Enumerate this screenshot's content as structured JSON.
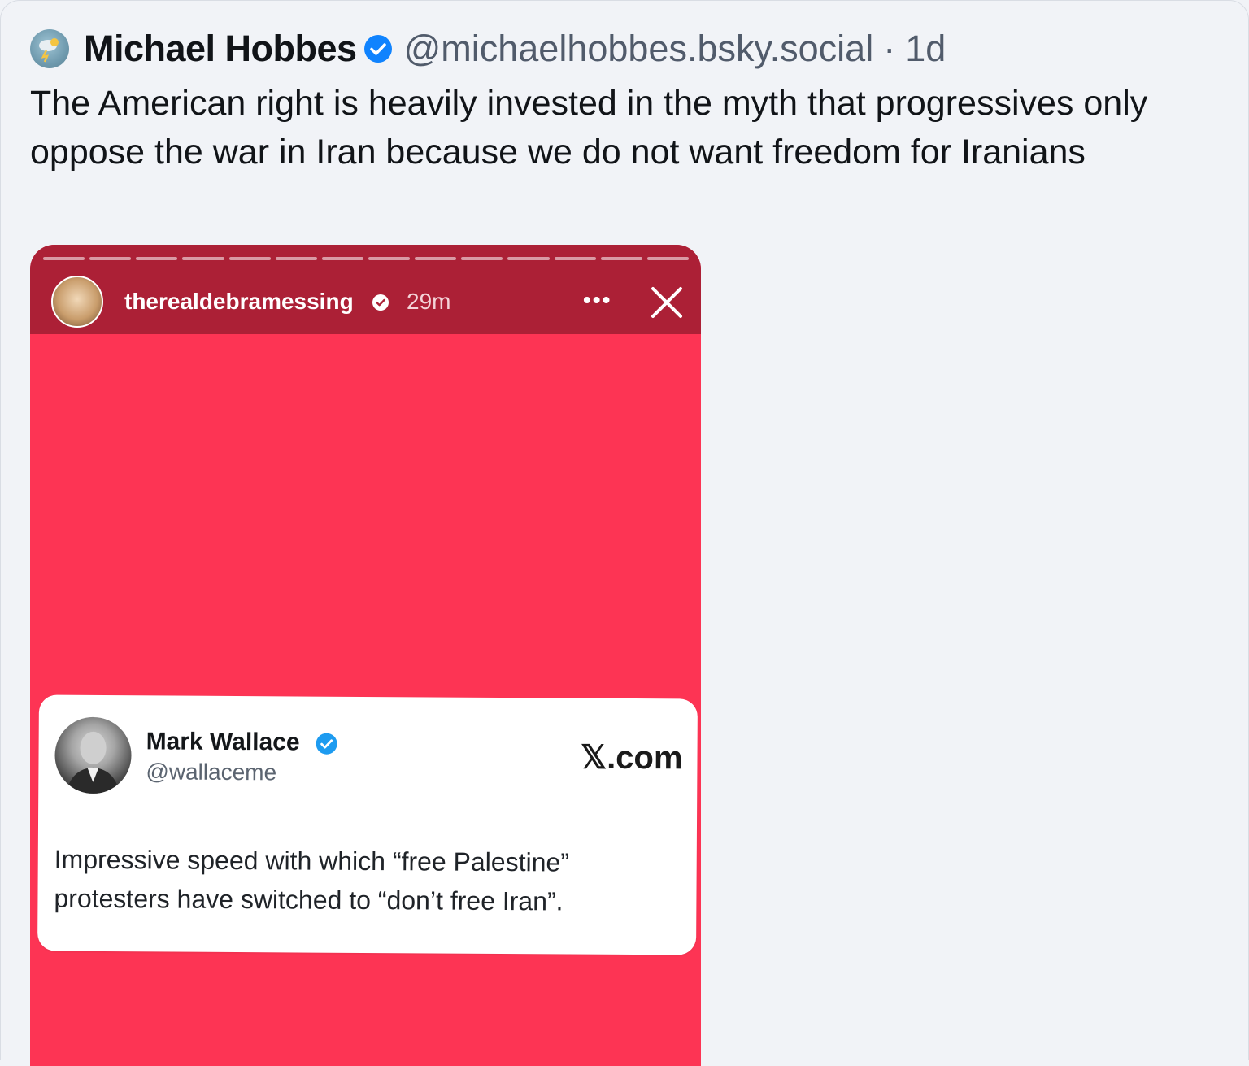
{
  "post": {
    "author_name": "Michael Hobbes",
    "author_handle": "@michaelhobbes.bsky.social",
    "separator": "·",
    "time": "1d",
    "text": "The American right is heavily invested in the myth that progressives only oppose the war in Iran because we do not want freedom for Iranians"
  },
  "embed": {
    "story": {
      "username": "therealdebramessing",
      "time": "29m",
      "more_label": "•••"
    },
    "tweet": {
      "name": "Mark Wallace",
      "handle": "@wallaceme",
      "source": "𝕏.com",
      "text": "Impressive speed with which “free Palestine” protesters have switched to “don’t free Iran”."
    }
  },
  "colors": {
    "page_background": "#f1f3f7",
    "verified_blue": "#1083fe",
    "story_background": "#fd3454",
    "story_topbar": "#ac2036"
  }
}
